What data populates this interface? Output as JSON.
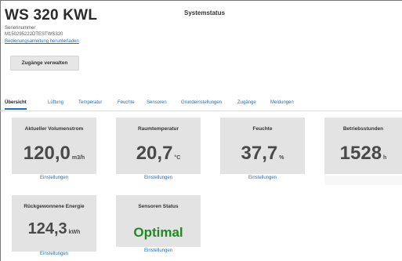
{
  "header": {
    "device_title": "WS 320 KWL",
    "serial_label": "Seriennummer",
    "serial_value": "M150295222DTESTWS320",
    "manual_link": "Bedienungsanleitung herunterladen",
    "system_status_title": "Systemstatus",
    "access_button": "Zugänge verwalten"
  },
  "tabs": [
    {
      "label": "Übersicht",
      "active": true
    },
    {
      "label": "Lüftung",
      "active": false
    },
    {
      "label": "Temperatur",
      "active": false
    },
    {
      "label": "Feuchte",
      "active": false
    },
    {
      "label": "Sensoren",
      "active": false
    },
    {
      "label": "Grundeinstellungen",
      "active": false
    },
    {
      "label": "Zugänge",
      "active": false
    },
    {
      "label": "Meldungen",
      "active": false
    }
  ],
  "cards": [
    {
      "title": "Aktueller Volumenstrom",
      "value": "120,0",
      "unit": "m3/h",
      "link": "Einstellungen"
    },
    {
      "title": "Raumtemperatur",
      "value": "20,7",
      "unit": "°C",
      "link": "Einstellungen"
    },
    {
      "title": "Feuchte",
      "value": "37,7",
      "unit": "%",
      "link": "Einstellungen"
    },
    {
      "title": "Betriebsstunden",
      "value": "1528",
      "unit": "h",
      "link": ""
    },
    {
      "title": "Rückgewonnene Energie",
      "value": "124,3",
      "unit": "kWh",
      "link": "Einstellungen"
    },
    {
      "title": "Sensoren Status",
      "value": "Optimal",
      "unit": "",
      "link": "Einstellungen"
    }
  ],
  "colors": {
    "link": "#1a6fc4",
    "status_ok": "#1f8a1f",
    "card_bg": "#e3e3e3"
  }
}
